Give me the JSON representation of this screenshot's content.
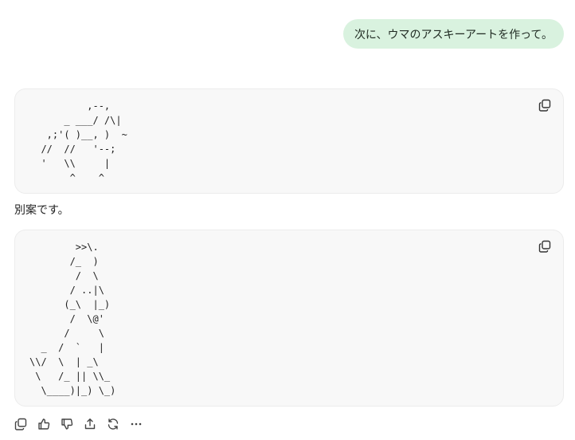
{
  "user_message": "次に、ウマのアスキーアートを作って。",
  "assistant": {
    "code_block_1": "          ,--,\n      _ ___/ /\\|\n   ,;'( )__, )  ~\n  //  //   '--;\n  '   \\\\     |\n       ^    ^",
    "between_text": "別案です。",
    "code_block_2": "        >>\\.\n       /_  )\n        /  \\\n       / ..|\\\n      (_\\  |_)\n       /  \\@'\n      /     \\\n  _  /  `   |\n\\\\/  \\  | _\\\n \\   /_ || \\\\_\n  \\____)|_) \\_)"
  },
  "icons": {
    "copy": "copy-icon",
    "actions": [
      "copy-icon",
      "thumbs-up-icon",
      "thumbs-down-icon",
      "share-icon",
      "regenerate-icon",
      "more-icon"
    ]
  },
  "colors": {
    "user_bubble": "#d9f2df",
    "code_bg": "#f8f8f8"
  }
}
